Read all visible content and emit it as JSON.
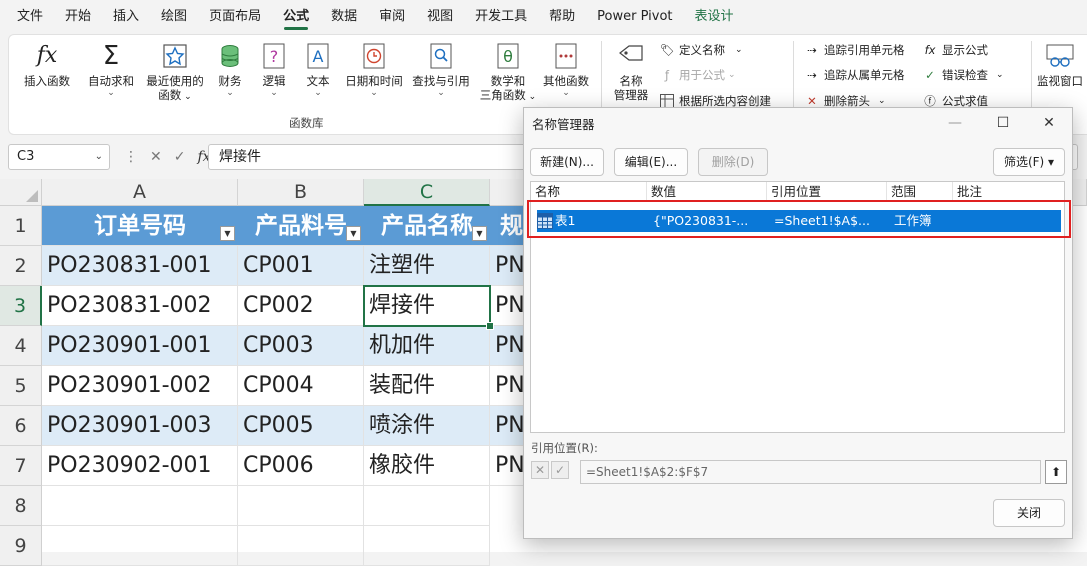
{
  "menu": {
    "tabs": [
      "文件",
      "开始",
      "插入",
      "绘图",
      "页面布局",
      "公式",
      "数据",
      "审阅",
      "视图",
      "开发工具",
      "帮助",
      "Power Pivot",
      "表设计"
    ],
    "active_index": 5
  },
  "ribbon": {
    "insert_function": "插入函数",
    "autosum": "自动求和",
    "recent_line1": "最近使用的",
    "recent_line2": "函数",
    "financial": "财务",
    "logical": "逻辑",
    "text": "文本",
    "datetime": "日期和时间",
    "lookup": "查找与引用",
    "math_line1": "数学和",
    "math_line2": "三角函数",
    "other": "其他函数",
    "group_label": "函数库",
    "name_mgr_line1": "名称",
    "name_mgr_line2": "管理器",
    "define_name": "定义名称",
    "use_in_formula": "用于公式",
    "create_from_sel": "根据所选内容创建",
    "trace_precedents": "追踪引用单元格",
    "trace_dependents": "追踪从属单元格",
    "remove_arrows": "删除箭头",
    "show_formulas": "显示公式",
    "error_checking": "错误检查",
    "evaluate_formula": "公式求值",
    "watch_window": "监视窗口"
  },
  "formula_bar": {
    "name_box": "C3",
    "fx": "fx",
    "content": "焊接件"
  },
  "sheet": {
    "columns": [
      "A",
      "B",
      "C"
    ],
    "rows": [
      "1",
      "2",
      "3",
      "4",
      "5",
      "6",
      "7",
      "8",
      "9"
    ],
    "headers": [
      "订单号码",
      "产品料号",
      "产品名称",
      "规"
    ],
    "data": [
      [
        "PO230831-001",
        "CP001",
        "注塑件",
        "PN"
      ],
      [
        "PO230831-002",
        "CP002",
        "焊接件",
        "PN"
      ],
      [
        "PO230901-001",
        "CP003",
        "机加件",
        "PN"
      ],
      [
        "PO230901-002",
        "CP004",
        "装配件",
        "PN"
      ],
      [
        "PO230901-003",
        "CP005",
        "喷涂件",
        "PN"
      ],
      [
        "PO230902-001",
        "CP006",
        "橡胶件",
        "PN"
      ]
    ]
  },
  "dialog": {
    "title": "名称管理器",
    "minimize": "—",
    "maximize": "☐",
    "close": "✕",
    "new_btn": "新建(N)...",
    "edit_btn": "编辑(E)...",
    "delete_btn": "删除(D)",
    "filter_btn": "筛选(F) ▾",
    "col_name": "名称",
    "col_value": "数值",
    "col_ref": "引用位置",
    "col_scope": "范围",
    "col_comment": "批注",
    "entry": {
      "name": "表1",
      "value": "{\"PO230831-...",
      "ref": "=Sheet1!$A$...",
      "scope": "工作簿"
    },
    "ref_label": "引用位置(R):",
    "ref_value": "=Sheet1!$A$2:$F$7",
    "close_btn": "关闭"
  }
}
